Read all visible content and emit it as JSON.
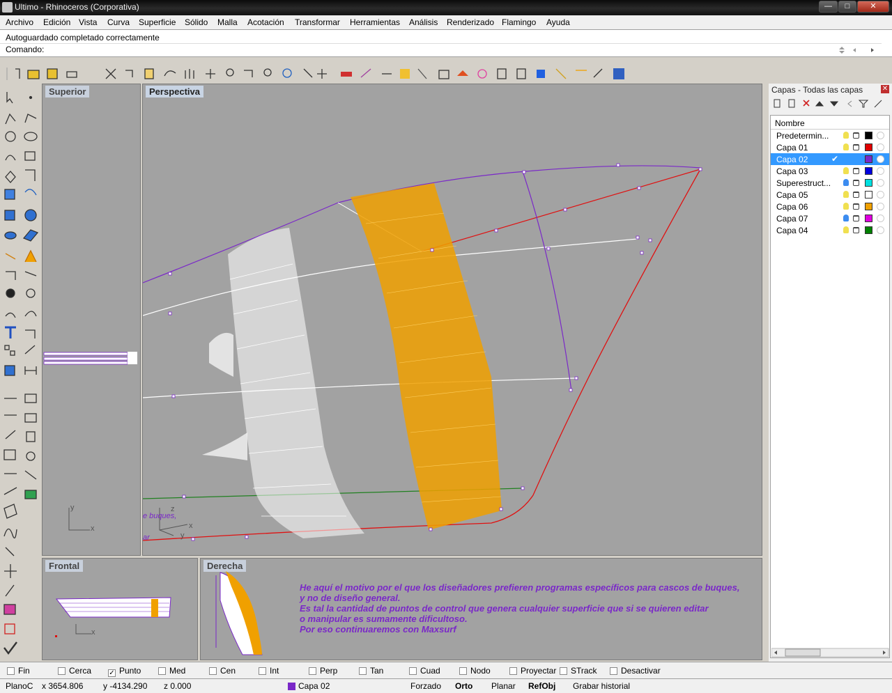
{
  "window": {
    "title": "Ultimo - Rhinoceros (Corporativa)",
    "controls": {
      "minimize": "—",
      "maximize": "□",
      "close": "✕"
    }
  },
  "menu": [
    "Archivo",
    "Edición",
    "Vista",
    "Curva",
    "Superficie",
    "Sólido",
    "Malla",
    "Acotación",
    "Transformar",
    "Herramientas",
    "Análisis",
    "Renderizado",
    "Flamingo",
    "Ayuda"
  ],
  "command": {
    "history": "Autoguardado completado correctamente",
    "prompt": "Comando:"
  },
  "viewports": {
    "top": "Superior",
    "perspective": "Perspectiva",
    "front": "Frontal",
    "right": "Derecha"
  },
  "overlay_text": {
    "perspective_partial_1": "e buques,",
    "perspective_partial_2": "ar",
    "note_lines": [
      "He aquí el motivo por el que los diseñadores prefieren programas específicos para cascos de buques,",
      "y no de diseño general.",
      "Es tal la cantidad de puntos de control que genera cualquier superficie que si se quieren editar",
      "o manipular es sumamente dificultoso.",
      "Por eso continuaremos con Maxsurf"
    ]
  },
  "axes": {
    "x": "x",
    "y": "y",
    "z": "z"
  },
  "layers": {
    "title": "Capas - Todas las capas",
    "column_name": "Nombre",
    "items": [
      {
        "name": "Predetermin...",
        "color": "#000000",
        "bulb": "#f0e050",
        "current": false
      },
      {
        "name": "Capa 01",
        "color": "#e00000",
        "bulb": "#f0e050",
        "current": false
      },
      {
        "name": "Capa 02",
        "color": "#7a28c8",
        "bulb": "#f0e050",
        "current": true
      },
      {
        "name": "Capa 03",
        "color": "#0000e0",
        "bulb": "#f0e050",
        "current": false
      },
      {
        "name": "Superestruct...",
        "color": "#00e0e0",
        "bulb": "#3c8cf0",
        "current": false
      },
      {
        "name": "Capa 05",
        "color": "#ffffff",
        "bulb": "#f0e050",
        "current": false
      },
      {
        "name": "Capa 06",
        "color": "#f0a000",
        "bulb": "#f0e050",
        "current": false
      },
      {
        "name": "Capa 07",
        "color": "#e000e0",
        "bulb": "#3c8cf0",
        "current": false
      },
      {
        "name": "Capa 04",
        "color": "#008000",
        "bulb": "#f0e050",
        "current": false
      }
    ],
    "current_check": "✔"
  },
  "osnaps": [
    {
      "label": "Fin",
      "checked": false
    },
    {
      "label": "Cerca",
      "checked": false
    },
    {
      "label": "Punto",
      "checked": true
    },
    {
      "label": "Med",
      "checked": false
    },
    {
      "label": "Cen",
      "checked": false
    },
    {
      "label": "Int",
      "checked": false
    },
    {
      "label": "Perp",
      "checked": false
    },
    {
      "label": "Tan",
      "checked": false
    },
    {
      "label": "Cuad",
      "checked": false
    },
    {
      "label": "Nodo",
      "checked": false
    },
    {
      "label": "Proyectar",
      "checked": false
    },
    {
      "label": "STrack",
      "checked": false
    },
    {
      "label": "Desactivar",
      "checked": false
    }
  ],
  "status": {
    "cplane": "PlanoC",
    "x": "x 3654.806",
    "y": "y -4134.290",
    "z": "z 0.000",
    "layer": "Capa 02",
    "layer_color": "#7a28c8",
    "forzado": "Forzado",
    "orto": "Orto",
    "planar": "Planar",
    "refobj": "RefObj",
    "history": "Grabar historial"
  },
  "colors": {
    "viewport_bg": "#a2a2a2",
    "hull_purple": "#7a28c8",
    "hull_red": "#e01010",
    "surface_orange": "#f0a000"
  }
}
